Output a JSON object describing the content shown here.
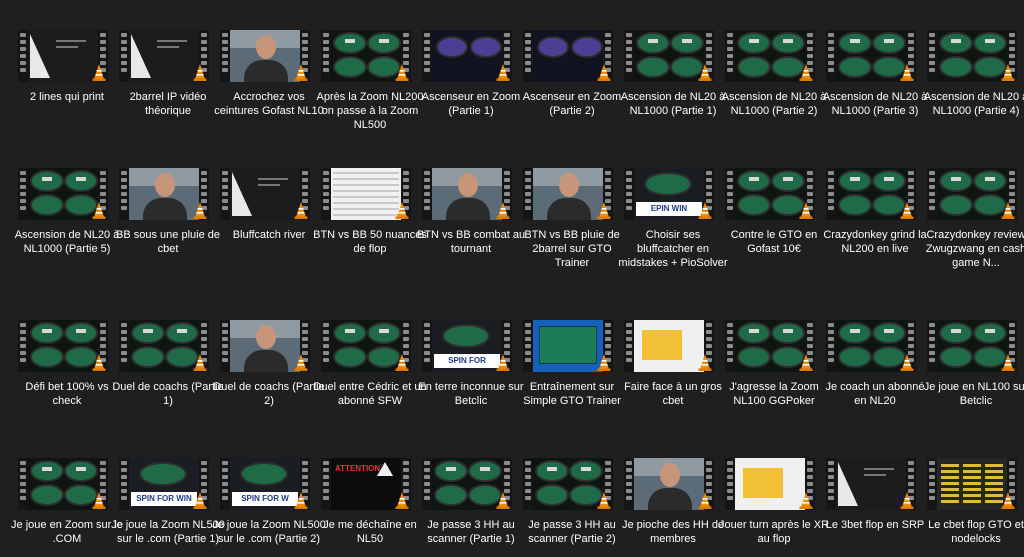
{
  "videos": [
    {
      "title": "2 lines qui print",
      "thumb": "slide"
    },
    {
      "title": "2barrel IP vidéo théorique",
      "thumb": "slide"
    },
    {
      "title": "Accrochez vos ceintures Gofast NL10",
      "thumb": "face"
    },
    {
      "title": "Après la Zoom NL200 on passe à la Zoom NL500",
      "thumb": "table"
    },
    {
      "title": "Ascenseur en Zoom (Partie 1)",
      "thumb": "lila"
    },
    {
      "title": "Ascenseur en Zoom (Partie 2)",
      "thumb": "lila"
    },
    {
      "title": "Ascension de NL20 à NL1000 (Partie 1)",
      "thumb": "table"
    },
    {
      "title": "Ascension de NL20 à NL1000 (Partie 2)",
      "thumb": "table"
    },
    {
      "title": "Ascension de NL20 à NL1000 (Partie 3)",
      "thumb": "table"
    },
    {
      "title": "Ascension de NL20 à NL1000 (Partie 4)",
      "thumb": "table"
    },
    {
      "title": "Ascension de NL20 à NL1000 (Partie 5)",
      "thumb": "table"
    },
    {
      "title": "BB sous une pluie de cbet",
      "thumb": "face"
    },
    {
      "title": "Bluffcatch river",
      "thumb": "slide"
    },
    {
      "title": "BTN vs BB 50 nuances de flop",
      "thumb": "sheet"
    },
    {
      "title": "BTN vs BB combat au tournant",
      "thumb": "face"
    },
    {
      "title": "BTN vs BB pluie de 2barrel sur GTO Trainer",
      "thumb": "face"
    },
    {
      "title": "Choisir ses bluffcatcher en midstakes + PioSolver",
      "thumb": "spin",
      "banner": "EPIN WIN"
    },
    {
      "title": "Contre le GTO en Gofast 10€",
      "thumb": "table"
    },
    {
      "title": "Crazydonkey grind la NL200 en live",
      "thumb": "table"
    },
    {
      "title": "Crazydonkey review Zwugzwang en cash game N...",
      "thumb": "table"
    },
    {
      "title": "Défi bet 100% vs check",
      "thumb": "table"
    },
    {
      "title": "Duel de coachs (Partie 1)",
      "thumb": "table"
    },
    {
      "title": "Duel de coachs (Partie 2)",
      "thumb": "face"
    },
    {
      "title": "Duel entre Cédric et un abonné SFW",
      "thumb": "table"
    },
    {
      "title": "En terre inconnue sur Betclic",
      "thumb": "spin",
      "banner": "SPIN FOR"
    },
    {
      "title": "Entraînement sur Simple GTO Trainer",
      "thumb": "blue"
    },
    {
      "title": "Faire face à un gros cbet",
      "thumb": "yellow"
    },
    {
      "title": "J'agresse la Zoom NL100 GGPoker",
      "thumb": "table"
    },
    {
      "title": "Je coach un abonné en NL20",
      "thumb": "table"
    },
    {
      "title": "Je joue en NL100 sur Betclic",
      "thumb": "table"
    },
    {
      "title": "Je joue en Zoom sur le .COM",
      "thumb": "table"
    },
    {
      "title": "Je joue la Zoom NL500 sur le .com (Partie 1)",
      "thumb": "spin",
      "banner": "SPIN FOR WIN"
    },
    {
      "title": "Je joue la Zoom NL500 sur le .com (Partie 2)",
      "thumb": "spin",
      "banner": "SPIN FOR W"
    },
    {
      "title": "Je me déchaîne en NL50",
      "thumb": "dark",
      "banner": "ATTENTION"
    },
    {
      "title": "Je passe 3 HH au scanner (Partie 1)",
      "thumb": "table"
    },
    {
      "title": "Je passe 3 HH au scanner (Partie 2)",
      "thumb": "table"
    },
    {
      "title": "Je pioche des HH de membres",
      "thumb": "face"
    },
    {
      "title": "Jouer turn après le XR au flop",
      "thumb": "yellow"
    },
    {
      "title": "Le 3bet flop en SRP",
      "thumb": "slide"
    },
    {
      "title": "Le cbet flop GTO et nodelocks",
      "thumb": "grid"
    }
  ],
  "icons": {
    "file_overlay": "vlc-cone-icon"
  },
  "colors": {
    "background": "#1f1f1f",
    "text": "#ffffff",
    "cone": "#f08c00"
  }
}
